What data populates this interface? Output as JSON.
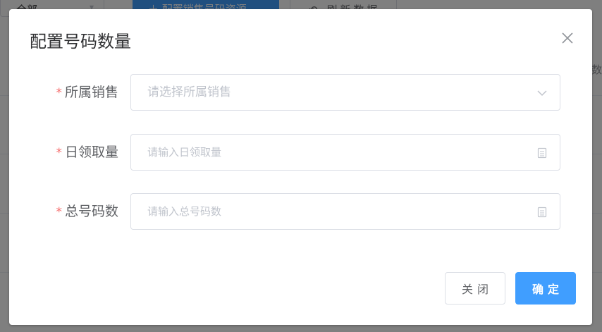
{
  "background": {
    "filter_value": "全部",
    "primary_button": "＋ 配置销售号码资源",
    "refresh_button": "刷新数据",
    "column_header_fragment": "数"
  },
  "dialog": {
    "title": "配置号码数量",
    "required_mark": "*",
    "fields": [
      {
        "label": "所属销售",
        "placeholder": "请选择所属销售",
        "value": "",
        "icon": "chevron-down-icon"
      },
      {
        "label": "日领取量",
        "placeholder": "请输入日领取量",
        "value": "",
        "icon": "document-icon"
      },
      {
        "label": "总号码数",
        "placeholder": "请输入总号码数",
        "value": "",
        "icon": "document-icon"
      }
    ],
    "buttons": {
      "close": "关闭",
      "confirm": "确定"
    }
  },
  "colors": {
    "primary": "#409eff",
    "required": "#f56c6c",
    "overlay": "rgba(0,0,0,0.5)"
  }
}
